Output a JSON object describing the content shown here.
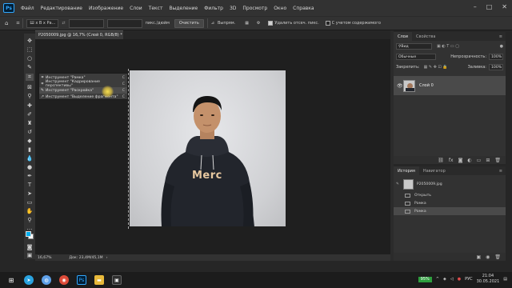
{
  "app": {
    "logo": "Ps"
  },
  "menu": [
    "Файл",
    "Редактирование",
    "Изображение",
    "Слои",
    "Текст",
    "Выделение",
    "Фильтр",
    "3D",
    "Просмотр",
    "Окно",
    "Справка"
  ],
  "window_controls": [
    "–",
    "□",
    "✕"
  ],
  "options_bar": {
    "ratio_select": "Ш x В x Ра…",
    "clear_button": "Очистить",
    "straighten_label": "Выпрям.",
    "delete_cropped_label": "Удалить отсеч. пикс.",
    "content_aware_label": "С учетом содержимого",
    "unit_label": "пикс./дюйм"
  },
  "document": {
    "tab_title": "P2050009.jpg @ 16,7% (Слой 0, RGB/8) *",
    "zoom": "16,67%",
    "doc_size": "Док: 23,4M/45,1M",
    "shirt_text": "Merc"
  },
  "flyout": {
    "items": [
      {
        "label": "Инструмент \"Рамка\"",
        "key": "C",
        "icon": "crop-icon"
      },
      {
        "label": "Инструмент \"Кадрирование перспективы\"",
        "key": "C",
        "icon": "perspective-crop-icon"
      },
      {
        "label": "Инструмент \"Раскройка\"",
        "key": "C",
        "icon": "slice-icon"
      },
      {
        "label": "Инструмент \"Выделение фрагмента\"",
        "key": "C",
        "icon": "slice-select-icon"
      }
    ],
    "selected_index": 2
  },
  "layers_panel": {
    "tabs": [
      "Слои",
      "Свойства"
    ],
    "filter_label": "Вид",
    "blend_mode": "Обычные",
    "opacity_label": "Непрозрачность:",
    "opacity_value": "100%",
    "lock_label": "Закрепить:",
    "fill_label": "Заливка:",
    "fill_value": "100%",
    "layer_name": "Слой 0"
  },
  "history_panel": {
    "tabs": [
      "История",
      "Навигатор"
    ],
    "snapshot": "P2050009.jpg",
    "items": [
      "Открыть",
      "Рамка",
      "Рамка"
    ]
  },
  "taskbar": {
    "battery": "95%",
    "language": "РУС",
    "time": "21:04",
    "date": "30.05.2021"
  },
  "colors": {
    "foreground": "#00aeef",
    "background": "#ffffff",
    "ps_blue": "#31a8ff"
  }
}
